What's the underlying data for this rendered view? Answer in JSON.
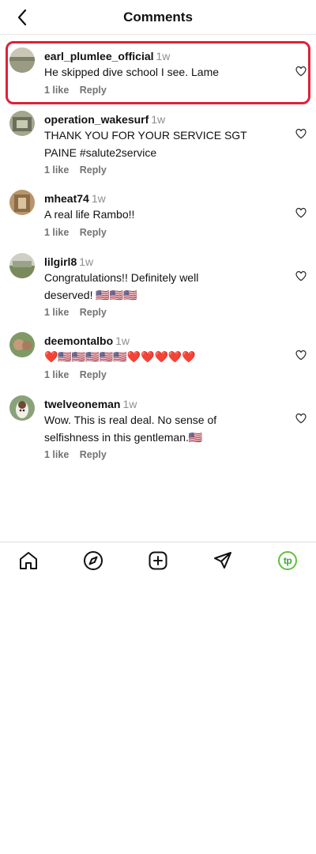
{
  "header": {
    "title": "Comments",
    "back_icon": "chevron-left-icon"
  },
  "comments": [
    {
      "username": "earl_plumlee_official",
      "time": "1w",
      "text": "He skipped dive school I see. Lame",
      "likes": "1 like",
      "reply": "Reply",
      "highlighted": true
    },
    {
      "username": "operation_wakesurf",
      "time": "1w",
      "text": "THANK YOU FOR YOUR SERVICE SGT PAINE #salute2service",
      "likes": "1 like",
      "reply": "Reply"
    },
    {
      "username": "mheat74",
      "time": "1w",
      "text": "A real life Rambo!!",
      "likes": "1 like",
      "reply": "Reply"
    },
    {
      "username": "lilgirl8",
      "time": "1w",
      "text": "Congratulations!! Definitely well deserved! 🇺🇸🇺🇸🇺🇸",
      "likes": "1 like",
      "reply": "Reply"
    },
    {
      "username": "deemontalbo",
      "time": "1w",
      "text": "❤️🇺🇸🇺🇸🇺🇸🇺🇸🇺🇸❤️❤️❤️❤️❤️",
      "likes": "1 like",
      "reply": "Reply"
    },
    {
      "username": "twelveoneman",
      "time": "1w",
      "text": "Wow. This is real deal. No sense of selfishness in this gentleman.🇺🇸",
      "likes": "1 like",
      "reply": "Reply"
    }
  ],
  "tabbar": {
    "items": [
      "home-icon",
      "explore-icon",
      "create-icon",
      "send-icon",
      "profile-avatar"
    ],
    "profile_initials": "tp"
  },
  "colors": {
    "highlight": "#e0203a",
    "profile_ring": "#5fc13b"
  }
}
